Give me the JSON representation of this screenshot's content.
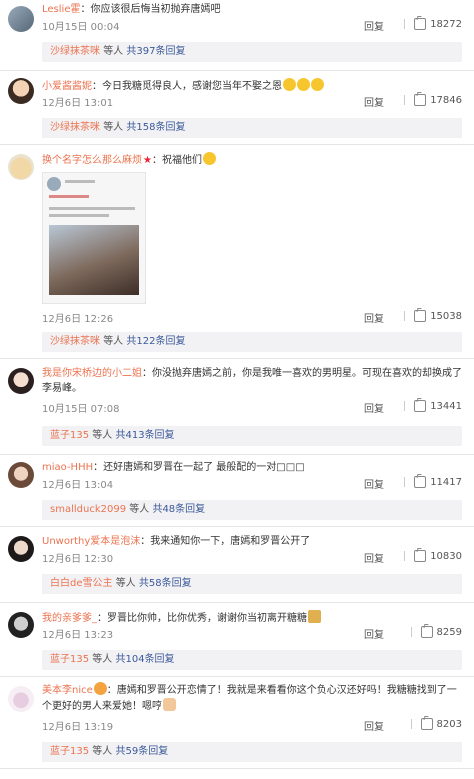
{
  "labels": {
    "reply": "回复",
    "sub_prefix_sep": "等人",
    "sub_total_prefix": "共",
    "sub_total_suffix": "条回复"
  },
  "comments": [
    {
      "user": "Leslie霍",
      "text": "：你应该很后悔当初抛弃唐嫣吧",
      "time": "10月15日 00:04",
      "likes": "18272",
      "sub_user": "沙绿抹茶咪",
      "sub_count": "397"
    },
    {
      "user": "小爱酱酱妮",
      "text": "：今日我糖觅得良人，感谢您当年不娶之恩",
      "time": "12月6日 13:01",
      "likes": "17846",
      "sub_user": "沙绿抹茶咪",
      "sub_count": "158"
    },
    {
      "user": "换个名字怎么那么麻烦",
      "text": "：祝福他们",
      "time": "12月6日 12:26",
      "likes": "15038",
      "sub_user": "沙绿抹茶咪",
      "sub_count": "122"
    },
    {
      "user": "我是你宋桥边的小二姐",
      "text": "：你没抛弃唐嫣之前，你是我唯一喜欢的男明星。可现在喜欢的却换成了李易峰。",
      "time": "10月15日 07:08",
      "likes": "13441",
      "sub_user": "蓝子135",
      "sub_count": "413"
    },
    {
      "user": "miao-HHH",
      "text": "：还好唐嫣和罗晋在一起了 最般配的一对□□□",
      "time": "12月6日 13:04",
      "likes": "11417",
      "sub_user": "smallduck2099",
      "sub_count": "48"
    },
    {
      "user": "Unworthy爱本是泡沫",
      "text": "：我来通知你一下，唐嫣和罗晋公开了",
      "time": "12月6日 12:30",
      "likes": "10830",
      "sub_user": "白白de雪公主",
      "sub_count": "58"
    },
    {
      "user": "我的亲爹爹_",
      "text": "：罗晋比你帅，比你优秀，谢谢你当初离开糖糖",
      "time": "12月6日 13:23",
      "likes": "8259",
      "sub_user": "蓝子135",
      "sub_count": "104"
    },
    {
      "user": "美本李nice",
      "text": "：唐嫣和罗晋公开恋情了！我就是来看看你这个负心汉还好吗！我糖糖找到了一个更好的男人来爱她！嗯哼",
      "time": "12月6日 13:19",
      "likes": "8203",
      "sub_user": "蓝子135",
      "sub_count": "59"
    }
  ]
}
